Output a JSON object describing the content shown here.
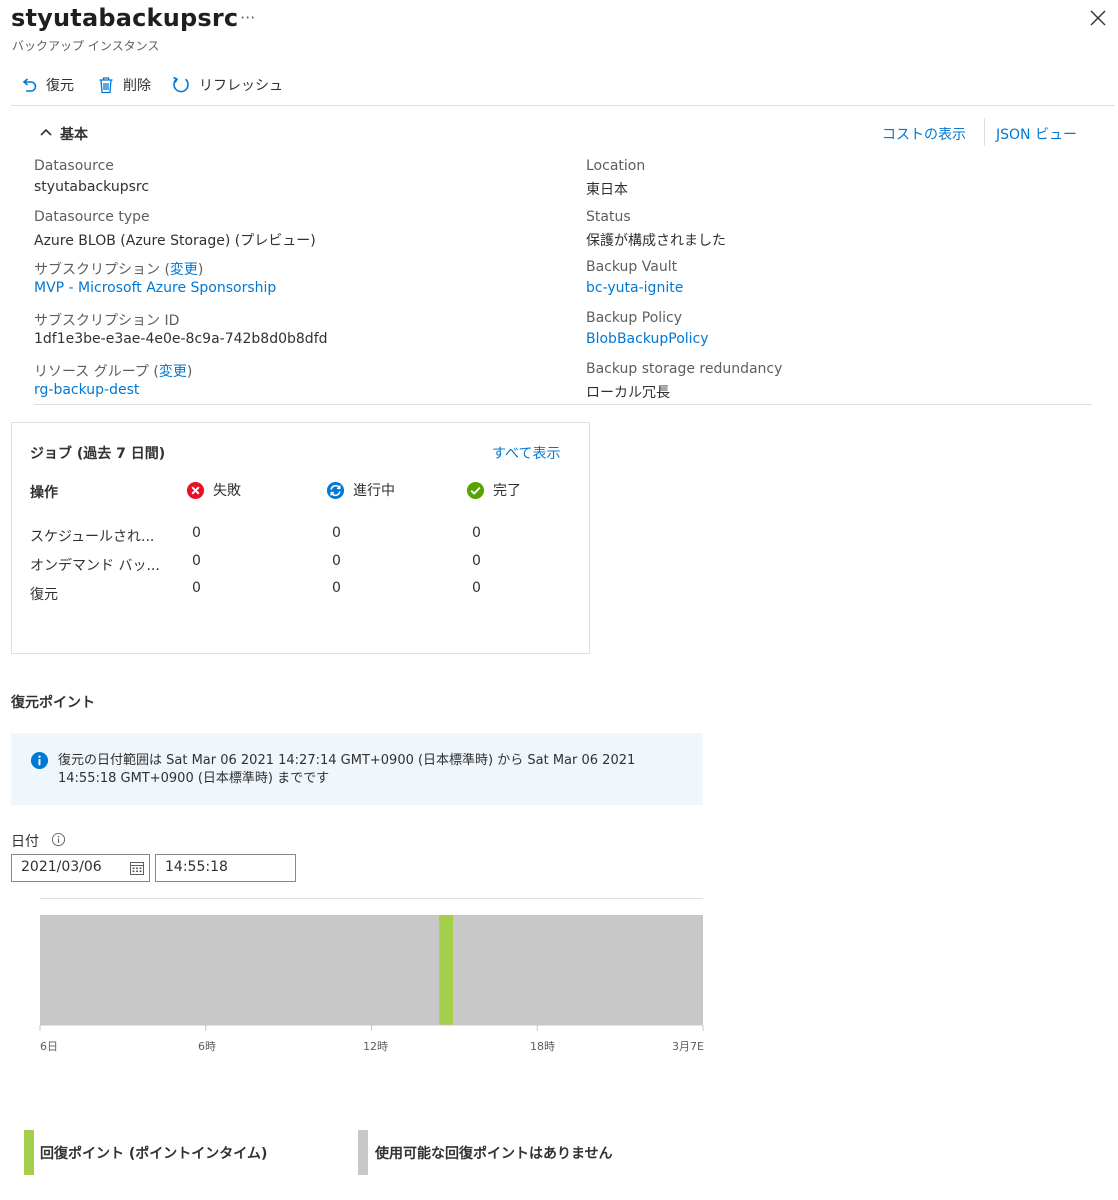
{
  "header": {
    "title": "styutabackupsrc",
    "more": "···",
    "subtitle": "バックアップ インスタンス"
  },
  "toolbar": {
    "restore": "復元",
    "delete": "削除",
    "refresh": "リフレッシュ"
  },
  "essentials": {
    "title": "基本",
    "cost_link": "コストの表示",
    "json_link": "JSON ビュー",
    "left": [
      {
        "label": "Datasource",
        "value": "styutabackupsrc"
      },
      {
        "label": "Datasource type",
        "value": "Azure BLOB (Azure Storage) (プレビュー)"
      },
      {
        "label": "サブスクリプション",
        "change": "変更",
        "value": "MVP - Microsoft Azure Sponsorship"
      },
      {
        "label": "サブスクリプション ID",
        "value": "1df1e3be-e3ae-4e0e-8c9a-742b8d0b8dfd"
      },
      {
        "label": "リソース グループ",
        "change": "変更",
        "value": "rg-backup-dest"
      }
    ],
    "right": [
      {
        "label": "Location",
        "value": "東日本"
      },
      {
        "label": "Status",
        "value": "保護が構成されました"
      },
      {
        "label": "Backup Vault",
        "value": "bc-yuta-ignite"
      },
      {
        "label": "Backup Policy",
        "value": "BlobBackupPolicy"
      },
      {
        "label": "Backup storage redundancy",
        "value": "ローカル冗長"
      }
    ]
  },
  "jobs": {
    "title": "ジョブ (過去 7 日間)",
    "view_all": "すべて表示",
    "op_header": "操作",
    "status_headers": [
      "失敗",
      "進行中",
      "完了"
    ],
    "rows": [
      {
        "label": "スケジュールされ...",
        "values": [
          "0",
          "0",
          "0"
        ]
      },
      {
        "label": "オンデマンド バッ...",
        "values": [
          "0",
          "0",
          "0"
        ]
      },
      {
        "label": "復元",
        "values": [
          "0",
          "0",
          "0"
        ]
      }
    ]
  },
  "recovery": {
    "title": "復元ポイント",
    "info_text": "復元の日付範囲は Sat Mar 06 2021 14:27:14 GMT+0900 (日本標準時) から Sat Mar 06 2021 14:55:18 GMT+0900 (日本標準時) までです",
    "date_label": "日付",
    "date_value": "2021/03/06",
    "time_value": "14:55:18",
    "timeline": {
      "ticks": [
        "6日",
        "6時",
        "12時",
        "18時",
        "3月7E"
      ],
      "range_hours": [
        0,
        24
      ],
      "recovery_point_hours": [
        14.45,
        14.95
      ],
      "colors": {
        "available": "#a4cf4c",
        "unavailable": "#c8c8c8"
      }
    },
    "legend": [
      {
        "label": "回復ポイント (ポイントインタイム)",
        "color": "#a4cf4c"
      },
      {
        "label": "使用可能な回復ポイントはありません",
        "color": "#c8c8c8"
      }
    ]
  }
}
